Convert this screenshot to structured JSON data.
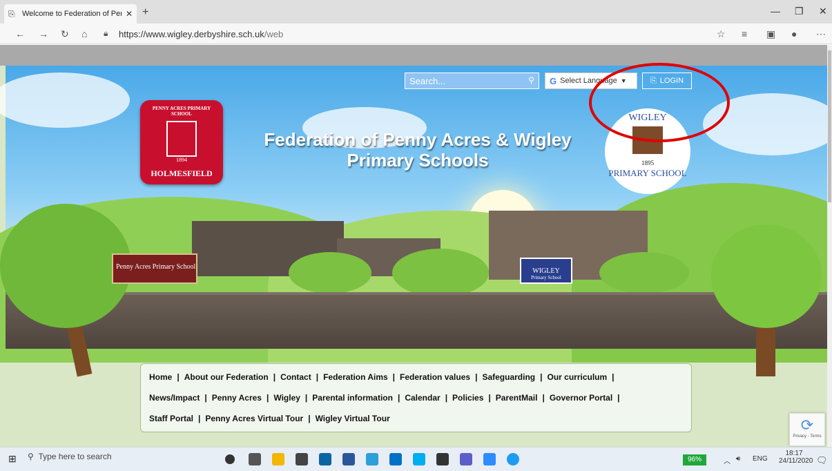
{
  "browser": {
    "tab_title": "Welcome to Federation of Penny",
    "tab_close": "✕",
    "new_tab": "+",
    "url_base": "https://www.wigley.derbyshire.sch.uk",
    "url_path": "/web"
  },
  "header": {
    "search_placeholder": "Search...",
    "language_label": "Select Language",
    "language_arrow": "▼",
    "login_label": "LOGIN",
    "title_line1": "Federation of Penny Acres & Wigley",
    "title_line2": "Primary Schools"
  },
  "logo_left": {
    "arc_text": "PENNY ACRES PRIMARY SCHOOL",
    "year": "1894",
    "place": "HOLMESFIELD"
  },
  "logo_right": {
    "top_text": "WIGLEY",
    "year": "1895",
    "bottom_text": "PRIMARY SCHOOL"
  },
  "signs": {
    "penny_acres": "Penny Acres Primary School",
    "wigley_name": "WIGLEY",
    "wigley_sub": "Primary School"
  },
  "nav": {
    "rows": [
      [
        "Home",
        "About our Federation",
        "Contact",
        "Federation Aims",
        "Federation values",
        "Safeguarding",
        "Our curriculum"
      ],
      [
        "News/Impact",
        "Penny Acres",
        "Wigley",
        "Parental information",
        "Calendar",
        "Policies",
        "ParentMail",
        "Governor Portal"
      ],
      [
        "Staff Portal",
        "Penny Acres Virtual Tour",
        "Wigley Virtual Tour"
      ]
    ]
  },
  "captcha": {
    "label": "Privacy - Terms"
  },
  "taskbar": {
    "search_placeholder": "Type here to search",
    "battery": "96%",
    "lang": "ENG",
    "time": "18:17",
    "date": "24/11/2020"
  },
  "colors": {
    "login_highlight": "#e00000",
    "hero_sky": "#4aa8e8",
    "logo_red": "#c8102e"
  }
}
